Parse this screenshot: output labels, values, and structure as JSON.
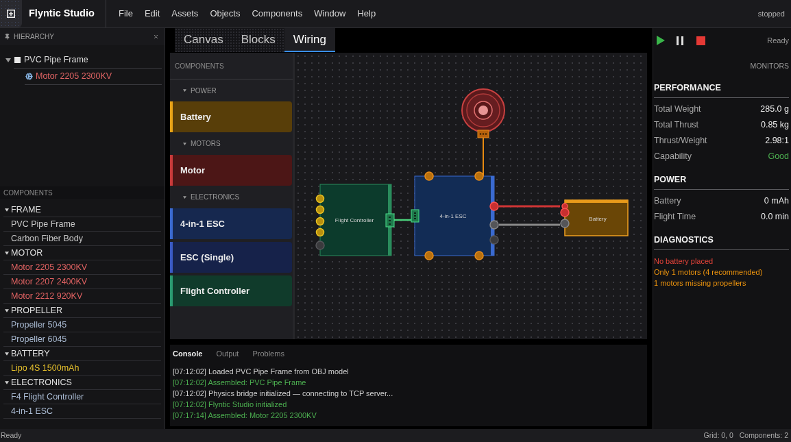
{
  "app": {
    "title": "Flyntic Studio",
    "run_state": "stopped"
  },
  "menu": [
    "File",
    "Edit",
    "Assets",
    "Objects",
    "Components",
    "Window",
    "Help"
  ],
  "hierarchy": {
    "title": "HIERARCHY",
    "tree": [
      {
        "label": "PVC Pipe Frame",
        "kind": "frame",
        "expanded": true,
        "children": [
          {
            "label": "Motor 2205 2300KV",
            "kind": "motor"
          }
        ]
      }
    ]
  },
  "library": {
    "title": "COMPONENTS",
    "categories": [
      {
        "name": "FRAME",
        "expanded": true,
        "items": [
          {
            "label": "PVC Pipe Frame",
            "color": "#c8c8c8"
          },
          {
            "label": "Carbon Fiber Body",
            "color": "#c8c8c8"
          }
        ]
      },
      {
        "name": "MOTOR",
        "expanded": true,
        "items": [
          {
            "label": "Motor 2205 2300KV",
            "color": "#e06262"
          },
          {
            "label": "Motor 2207 2400KV",
            "color": "#e06262"
          },
          {
            "label": "Motor 2212 920KV",
            "color": "#e06262"
          }
        ]
      },
      {
        "name": "PROPELLER",
        "expanded": true,
        "items": [
          {
            "label": "Propeller 5045",
            "color": "#a9bad2"
          },
          {
            "label": "Propeller 6045",
            "color": "#a9bad2"
          }
        ]
      },
      {
        "name": "BATTERY",
        "expanded": true,
        "items": [
          {
            "label": "Lipo 4S 1500mAh",
            "color": "#e8c22c"
          }
        ]
      },
      {
        "name": "ELECTRONICS",
        "expanded": true,
        "items": [
          {
            "label": "F4 Flight Controller",
            "color": "#a9bad2"
          },
          {
            "label": "4-in-1 ESC",
            "color": "#a9bad2"
          }
        ]
      }
    ]
  },
  "view_tabs": [
    {
      "label": "Canvas",
      "selected": false
    },
    {
      "label": "Blocks",
      "selected": false
    },
    {
      "label": "Wiring",
      "selected": true
    }
  ],
  "palette": {
    "title": "COMPONENTS",
    "groups": [
      {
        "name": "POWER",
        "expanded": true,
        "blocks": [
          {
            "label": "Battery",
            "color": "#e8a317"
          }
        ]
      },
      {
        "name": "MOTORS",
        "expanded": true,
        "blocks": [
          {
            "label": "Motor",
            "color": "#c83a3a"
          }
        ]
      },
      {
        "name": "ELECTRONICS",
        "expanded": true,
        "blocks": [
          {
            "label": "4-in-1 ESC",
            "color": "#3a6ad0"
          },
          {
            "label": "ESC (Single)",
            "color": "#3a5ac4"
          },
          {
            "label": "Flight Controller",
            "color": "#2a9a70"
          }
        ]
      }
    ]
  },
  "canvas": {
    "nodes": [
      {
        "kind": "motor"
      },
      {
        "kind": "flight_controller",
        "label": "Flight Controller"
      },
      {
        "kind": "esc",
        "label": "4-in-1 ESC"
      },
      {
        "kind": "battery",
        "label": "Battery"
      }
    ]
  },
  "console": {
    "tabs": [
      {
        "label": "Console",
        "selected": true
      },
      {
        "label": "Output",
        "selected": false
      },
      {
        "label": "Problems",
        "selected": false
      }
    ],
    "lines": [
      {
        "text": "[07:12:02] Loaded PVC Pipe Frame from OBJ model",
        "kind": "info"
      },
      {
        "text": "[07:12:02] Assembled: PVC Pipe Frame",
        "kind": "success"
      },
      {
        "text": "[07:12:02] Physics bridge initialized — connecting to TCP server...",
        "kind": "info"
      },
      {
        "text": "[07:12:02] Flyntic Studio initialized",
        "kind": "success"
      },
      {
        "text": "[07:17:14] Assembled: Motor 2205 2300KV",
        "kind": "success"
      }
    ]
  },
  "simulation": {
    "status": "Ready"
  },
  "monitors": {
    "title": "MONITORS",
    "sections": [
      {
        "title": "PERFORMANCE",
        "rows": [
          {
            "label": "Total Weight",
            "value": "285.0 g",
            "kind": "normal"
          },
          {
            "label": "Total Thrust",
            "value": "0.85 kg",
            "kind": "normal"
          },
          {
            "label": "Thrust/Weight",
            "value": "2.98:1",
            "kind": "normal"
          },
          {
            "label": "Capability",
            "value": "Good",
            "kind": "good"
          }
        ]
      },
      {
        "title": "POWER",
        "rows": [
          {
            "label": "Battery",
            "value": "0 mAh",
            "kind": "normal"
          },
          {
            "label": "Flight Time",
            "value": "0.0 min",
            "kind": "normal"
          }
        ]
      },
      {
        "title": "DIAGNOSTICS",
        "messages": [
          {
            "text": "No battery placed",
            "kind": "error"
          },
          {
            "text": "Only 1 motors (4 recommended)",
            "kind": "warning"
          },
          {
            "text": "1 motors missing propellers",
            "kind": "warning"
          }
        ]
      }
    ]
  },
  "status_bar": {
    "left": "Ready",
    "right": [
      "Grid: 0, 0",
      "Components: 2"
    ]
  }
}
